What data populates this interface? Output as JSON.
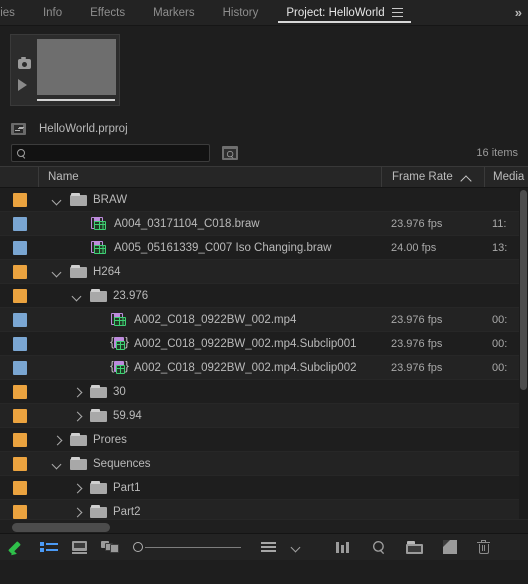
{
  "tabs": [
    {
      "label": "aries",
      "active": false,
      "truncated": true
    },
    {
      "label": "Info",
      "active": false
    },
    {
      "label": "Effects",
      "active": false
    },
    {
      "label": "Markers",
      "active": false
    },
    {
      "label": "History",
      "active": false
    },
    {
      "label": "Project: HelloWorld",
      "active": true
    }
  ],
  "tab_overflow_label": "»",
  "preview": {
    "camera_icon": "camera-icon",
    "play_icon": "play-icon"
  },
  "project": {
    "name": "HelloWorld.prproj",
    "up_icon": "navigate-up-folder-icon"
  },
  "search": {
    "value": "",
    "placeholder": "",
    "icon": "search-icon",
    "find_button_icon": "find-in-project-icon"
  },
  "item_count": "16 items",
  "columns": [
    {
      "key": "swatch",
      "label": ""
    },
    {
      "key": "name",
      "label": "Name"
    },
    {
      "key": "fps",
      "label": "Frame Rate",
      "sorted": true,
      "sort_dir": "asc"
    },
    {
      "key": "media",
      "label": "Media"
    }
  ],
  "rows": [
    {
      "swatch": "bin",
      "depth": 0,
      "twisty": "open",
      "icon": "folder-icon",
      "name": "BRAW",
      "fps": "",
      "media": ""
    },
    {
      "swatch": "clip",
      "depth": 1,
      "twisty": "none",
      "icon": "clip-icon",
      "name": "A004_03171104_C018.braw",
      "fps": "23.976 fps",
      "media": "11:"
    },
    {
      "swatch": "clip",
      "depth": 1,
      "twisty": "none",
      "icon": "clip-icon",
      "name": "A005_05161339_C007 Iso Changing.braw",
      "fps": "24.00 fps",
      "media": "13:"
    },
    {
      "swatch": "bin",
      "depth": 0,
      "twisty": "open",
      "icon": "folder-icon",
      "name": "H264",
      "fps": "",
      "media": ""
    },
    {
      "swatch": "bin",
      "depth": 1,
      "twisty": "open",
      "icon": "folder-icon",
      "name": "23.976",
      "fps": "",
      "media": ""
    },
    {
      "swatch": "clip",
      "depth": 2,
      "twisty": "none",
      "icon": "clip-icon",
      "name": "A002_C018_0922BW_002.mp4",
      "fps": "23.976 fps",
      "media": "00:"
    },
    {
      "swatch": "clip",
      "depth": 2,
      "twisty": "none",
      "icon": "subclip-icon",
      "name": "A002_C018_0922BW_002.mp4.Subclip001",
      "fps": "23.976 fps",
      "media": "00:"
    },
    {
      "swatch": "clip",
      "depth": 2,
      "twisty": "none",
      "icon": "subclip-icon",
      "name": "A002_C018_0922BW_002.mp4.Subclip002",
      "fps": "23.976 fps",
      "media": "00:"
    },
    {
      "swatch": "bin",
      "depth": 1,
      "twisty": "closed",
      "icon": "folder-icon",
      "name": "30",
      "fps": "",
      "media": ""
    },
    {
      "swatch": "bin",
      "depth": 1,
      "twisty": "closed",
      "icon": "folder-icon",
      "name": "59.94",
      "fps": "",
      "media": ""
    },
    {
      "swatch": "bin",
      "depth": 0,
      "twisty": "closed",
      "icon": "folder-icon",
      "name": "Prores",
      "fps": "",
      "media": ""
    },
    {
      "swatch": "bin",
      "depth": 0,
      "twisty": "open",
      "icon": "folder-icon",
      "name": "Sequences",
      "fps": "",
      "media": ""
    },
    {
      "swatch": "bin",
      "depth": 1,
      "twisty": "closed",
      "icon": "folder-icon",
      "name": "Part1",
      "fps": "",
      "media": ""
    },
    {
      "swatch": "bin",
      "depth": 1,
      "twisty": "closed",
      "icon": "folder-icon",
      "name": "Part2",
      "fps": "",
      "media": ""
    }
  ],
  "toolbar": {
    "left": [
      {
        "icon": "pencil-icon",
        "name": "project-writable-toggle"
      },
      {
        "icon": "list-view-icon",
        "name": "list-view-button"
      },
      {
        "icon": "icon-view-icon",
        "name": "icon-view-button"
      },
      {
        "icon": "freeform-view-icon",
        "name": "freeform-view-button"
      },
      {
        "icon": "zoom-slider",
        "name": "thumbnail-zoom-slider"
      },
      {
        "icon": "sort-icon",
        "name": "sort-icon-button"
      },
      {
        "icon": "chevron-down-icon",
        "name": "sort-options-caret"
      }
    ],
    "right": [
      {
        "icon": "columns-icon",
        "name": "automate-to-sequence-button"
      },
      {
        "icon": "search-icon",
        "name": "find-button"
      },
      {
        "icon": "new-bin-icon",
        "name": "new-bin-button"
      },
      {
        "icon": "new-item-icon",
        "name": "new-item-button"
      },
      {
        "icon": "trash-icon",
        "name": "clear-button"
      }
    ]
  },
  "colors": {
    "bin_swatch": "#eba33f",
    "clip_swatch": "#7aa6d2",
    "accent_green": "#2fc04a",
    "accent_blue": "#4b9af5",
    "panel_bg": "#1e1e1e"
  }
}
